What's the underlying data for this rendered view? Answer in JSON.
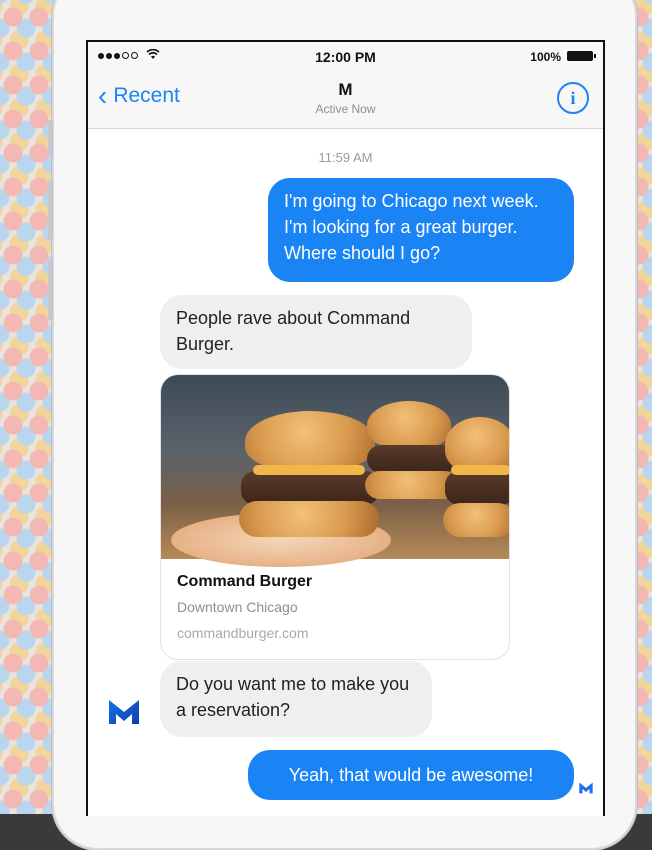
{
  "status_bar": {
    "time": "12:00 PM",
    "battery": "100%"
  },
  "nav": {
    "back_label": "Recent",
    "title": "M",
    "subtitle": "Active Now",
    "info_icon": "i"
  },
  "conversation": {
    "timestamp": "11:59 AM",
    "messages": [
      {
        "from": "user",
        "text": "I'm going to Chicago next week. I'm looking for a great burger. Where should I go?"
      },
      {
        "from": "m",
        "text": "People rave about Command Burger."
      },
      {
        "from": "m",
        "text": "Do you want me to make you a reservation?"
      },
      {
        "from": "user",
        "text": "Yeah, that would be awesome!"
      }
    ],
    "card": {
      "title": "Command Burger",
      "subtitle": "Downtown Chicago",
      "link": "commandburger.com"
    }
  },
  "colors": {
    "accent": "#1a84f5",
    "incoming_bubble": "#efeff2",
    "background": "#3a3a3c"
  }
}
